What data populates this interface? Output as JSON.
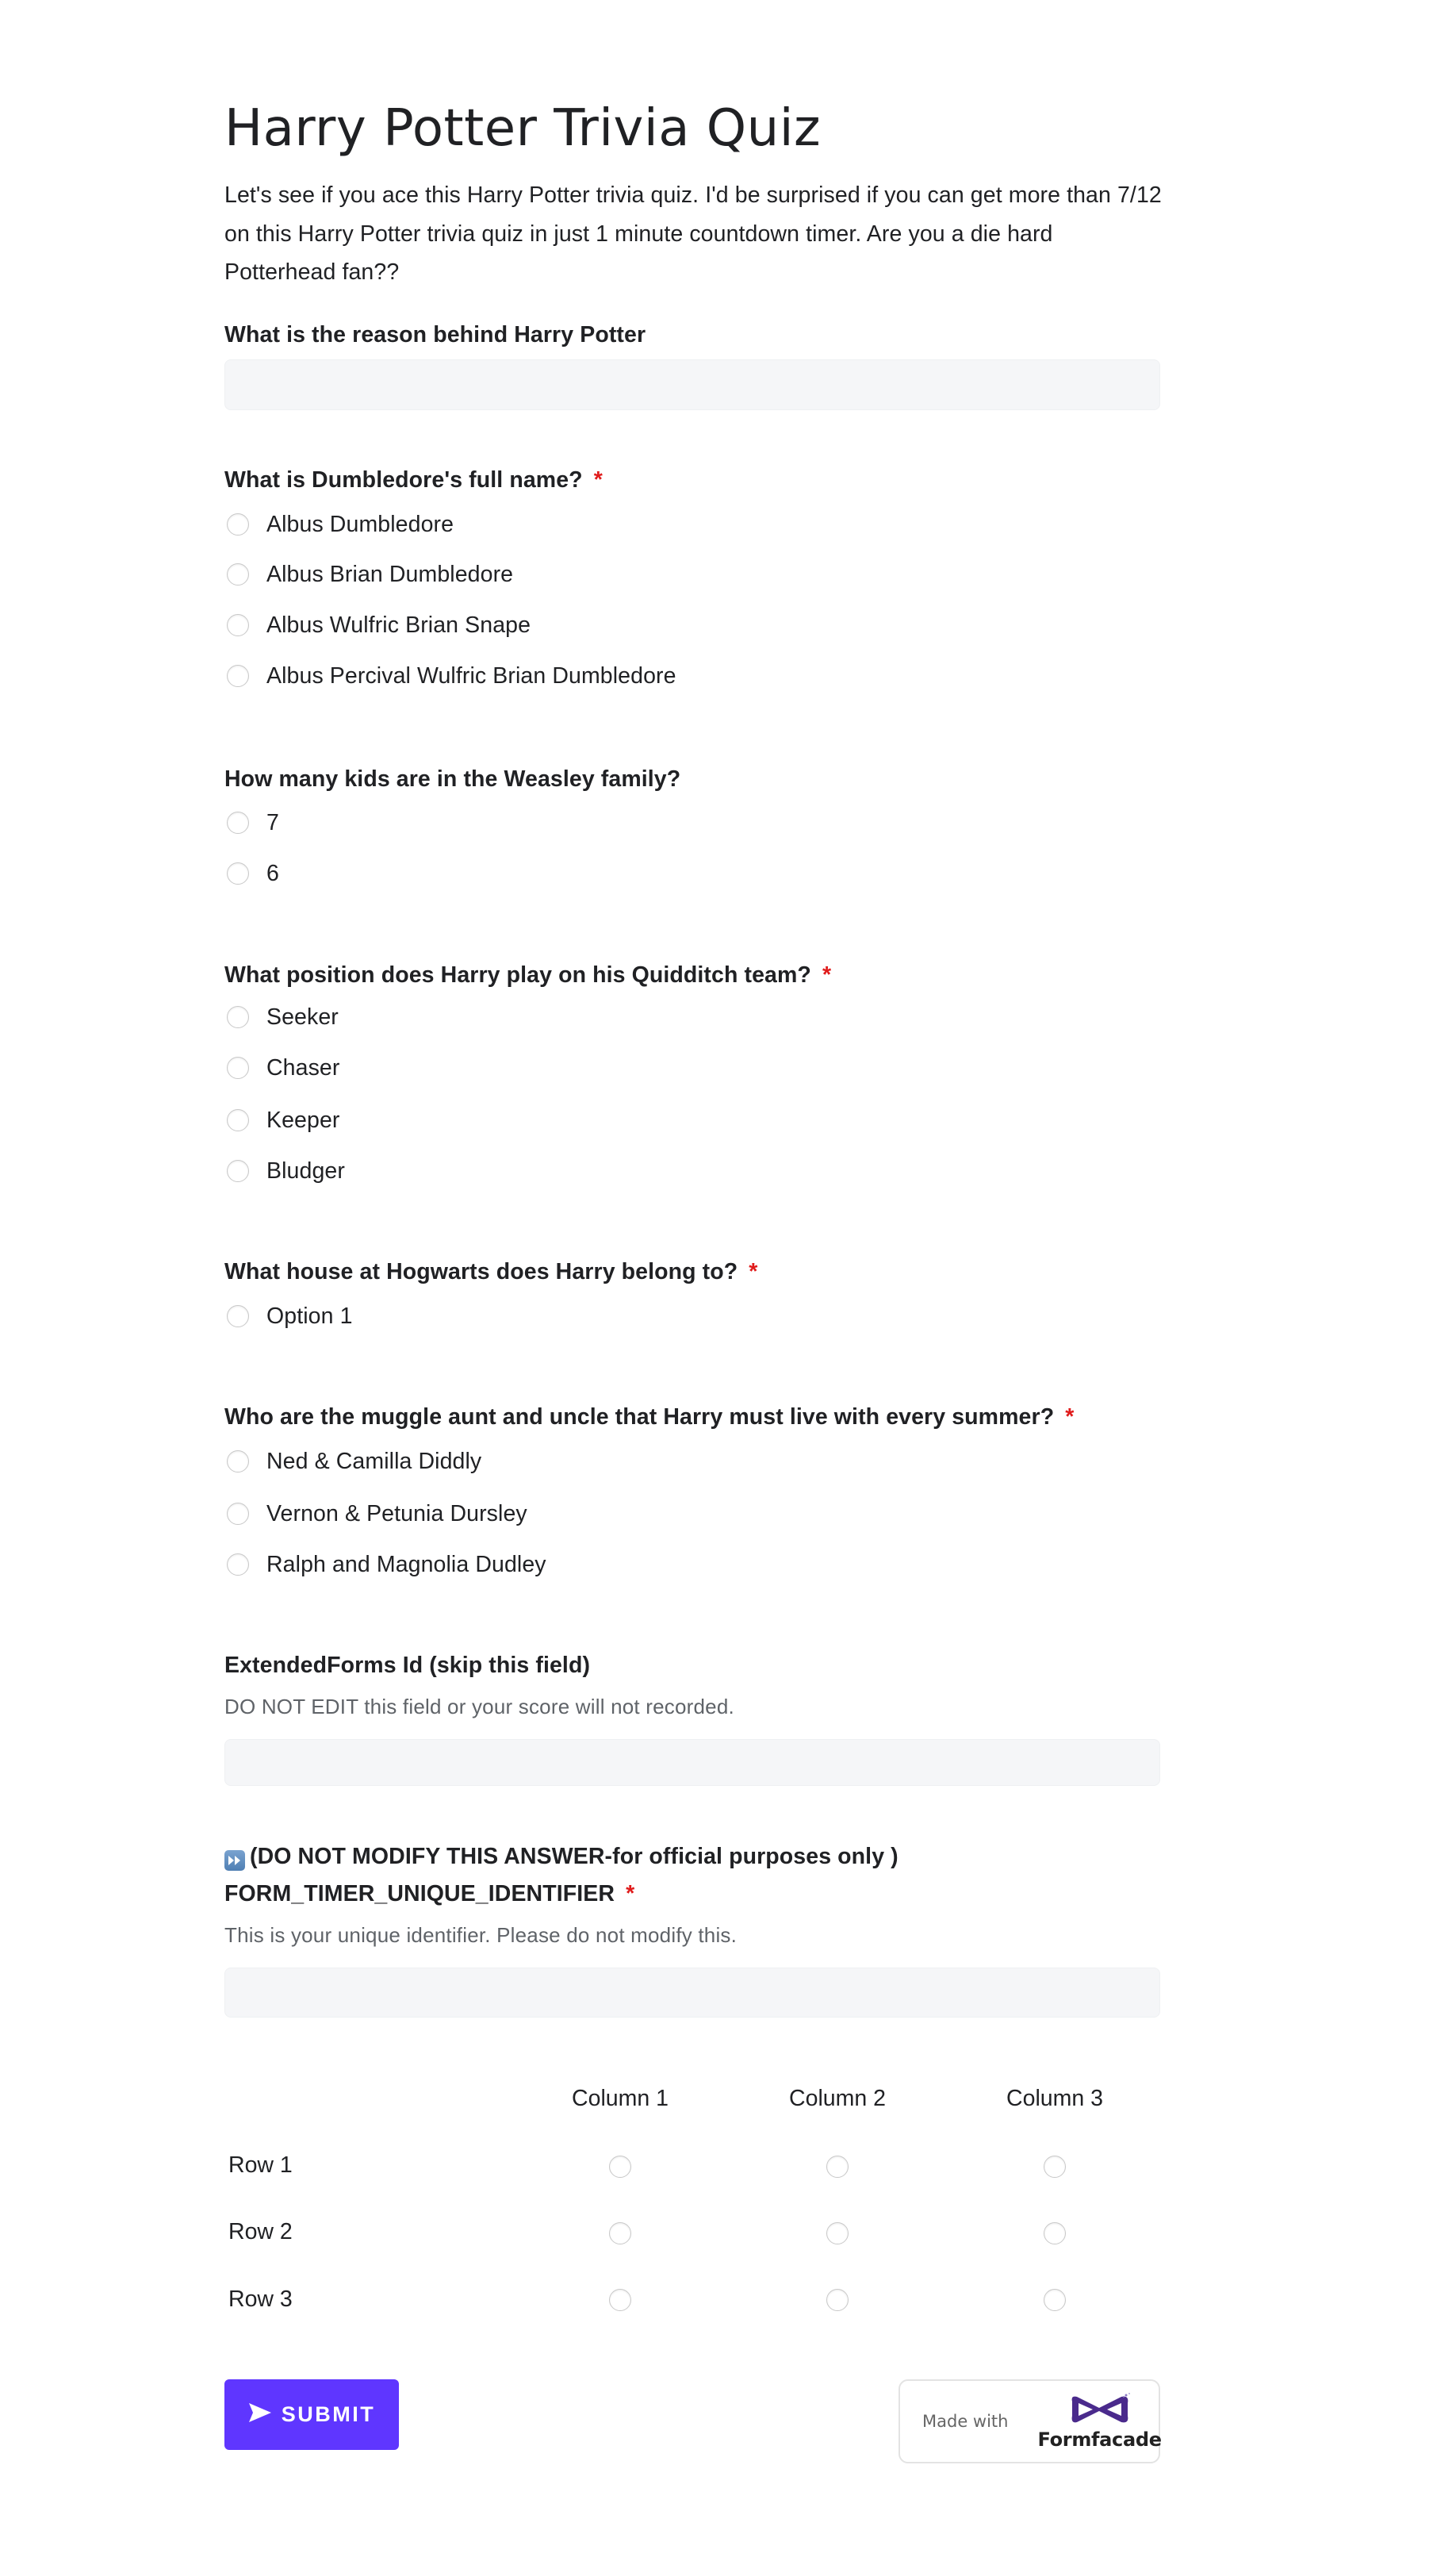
{
  "form": {
    "title": "Harry Potter Trivia Quiz",
    "description": "Let's see if you ace this Harry Potter trivia quiz. I'd be surprised if you can get more than 7/12 on this Harry Potter trivia quiz in just 1 minute countdown timer. Are you a die hard Potterhead fan??",
    "required_marker": "*"
  },
  "questions": {
    "q1": {
      "label": "What is the reason behind Harry Potter",
      "required": false,
      "type": "text",
      "value": "",
      "placeholder": ""
    },
    "q2": {
      "label": "What is Dumbledore's full name?",
      "required": true,
      "type": "radio",
      "options": [
        "Albus Dumbledore",
        "Albus Brian Dumbledore",
        "Albus Wulfric Brian Snape",
        "Albus Percival Wulfric Brian Dumbledore"
      ]
    },
    "q3": {
      "label": "How many kids are in the Weasley family?",
      "required": false,
      "type": "radio",
      "options": [
        "7",
        "6"
      ]
    },
    "q4": {
      "label": "What position does Harry play on his Quidditch team?",
      "required": true,
      "type": "radio",
      "options": [
        "Seeker",
        "Chaser",
        "Keeper",
        "Bludger"
      ]
    },
    "q5": {
      "label": "What house at Hogwarts does Harry belong to?",
      "required": true,
      "type": "radio",
      "options": [
        "Option 1"
      ]
    },
    "q6": {
      "label": "Who are the muggle aunt and uncle that Harry must live with every summer?",
      "required": true,
      "type": "radio",
      "options": [
        "Ned & Camilla Diddly",
        "Vernon & Petunia Dursley",
        "Ralph and Magnolia Dudley"
      ]
    },
    "extended_id": {
      "label": "ExtendedForms Id (skip this field)",
      "help": "DO NOT EDIT this field or your score will not recorded.",
      "value": ""
    },
    "timer": {
      "icon": "fast-forward-icon",
      "label_line1": "(DO NOT MODIFY THIS ANSWER-for official purposes only )",
      "label_line2": "FORM_TIMER_UNIQUE_IDENTIFIER",
      "required": true,
      "help": "This is your unique identifier. Please do not modify this.",
      "value": ""
    }
  },
  "grid": {
    "columns": [
      "Column 1",
      "Column 2",
      "Column 3"
    ],
    "rows": [
      "Row 1",
      "Row 2",
      "Row 3"
    ]
  },
  "footer": {
    "submit_label": "SUBMIT",
    "submit_icon": "send-icon",
    "badge_prefix": "Made with",
    "badge_brand": "Formfacade"
  },
  "colors": {
    "accent": "#5f36ff",
    "required": "#e01b1b",
    "input_bg": "#f5f6f8",
    "text": "#202124",
    "help_text": "#5f6368"
  }
}
